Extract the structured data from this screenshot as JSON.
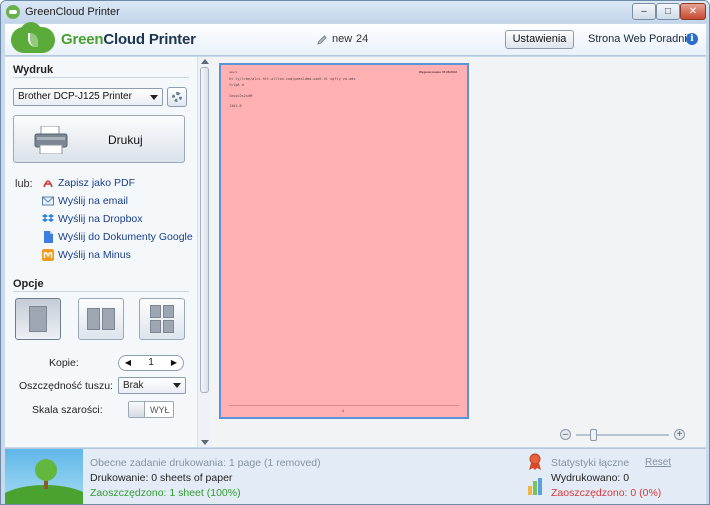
{
  "window": {
    "title": "GreenCloud Printer",
    "minimize_label": "–",
    "maximize_label": "□",
    "close_label": "✕"
  },
  "header": {
    "logo_green": "Green",
    "logo_dark": "Cloud Printer",
    "doc_name": "new",
    "doc_pages": "24",
    "settings_label": "Ustawienia",
    "links": "Strona Web Poradnik",
    "info_label": "i"
  },
  "print_section": {
    "title": "Wydruk",
    "printer": "Brother DCP-J125 Printer",
    "print_label": "Drukuj",
    "or_label": "lub:",
    "actions": [
      {
        "label": "Zapisz jako PDF",
        "icon": "pdf-icon"
      },
      {
        "label": "Wyślij na email",
        "icon": "email-icon"
      },
      {
        "label": "Wyślij na Dropbox",
        "icon": "dropbox-icon"
      },
      {
        "label": "Wyślij do Dokumenty Google",
        "icon": "google-docs-icon"
      },
      {
        "label": "Wyślij na Minus",
        "icon": "minus-icon"
      }
    ]
  },
  "options": {
    "title": "Opcje",
    "layout_modes": [
      "1-page",
      "2-pages",
      "4-pages"
    ],
    "active_layout": "1-page",
    "copies_label": "Kopie:",
    "copies_value": "1",
    "copies_dec": "◀",
    "copies_inc": "▶",
    "ink_label": "Oszczędność tuszu:",
    "ink_value": "Brak",
    "grayscale_label": "Skala szarości:",
    "grayscale_state": "WYŁ"
  },
  "preview": {
    "page_color": "#ffb0b2",
    "header_left": "new 3",
    "header_right": "Wygenerowano 07.08.2012",
    "lines": [
      "ht.ly/lrbe/alci.htt.alllon.com/paesldmd-sadl.hl ngfly zd.adx",
      "fclgA d",
      "",
      "Iosoc2s2sdM",
      "",
      "13d1-6"
    ],
    "footer_number": "4",
    "zoom_minus": "–",
    "zoom_plus": "+"
  },
  "footer": {
    "current_job": "Obecne zadanie drukowania: 1 page (1 removed)",
    "printing": "Drukowanie: 0 sheets of paper",
    "saved": "Zaoszczędzono: 1 sheet (100%)",
    "stats_title": "Statystyki łączne",
    "reset_label": "Reset",
    "printed_total": "Wydrukowano: 0",
    "saved_total": "Zaoszczędzono: 0 (0%)",
    "colors": {
      "saved_green": "#2f9d2f",
      "saved_red": "#d9373d",
      "muted": "#8692a0",
      "link_blue": "#1a3f8a"
    }
  }
}
